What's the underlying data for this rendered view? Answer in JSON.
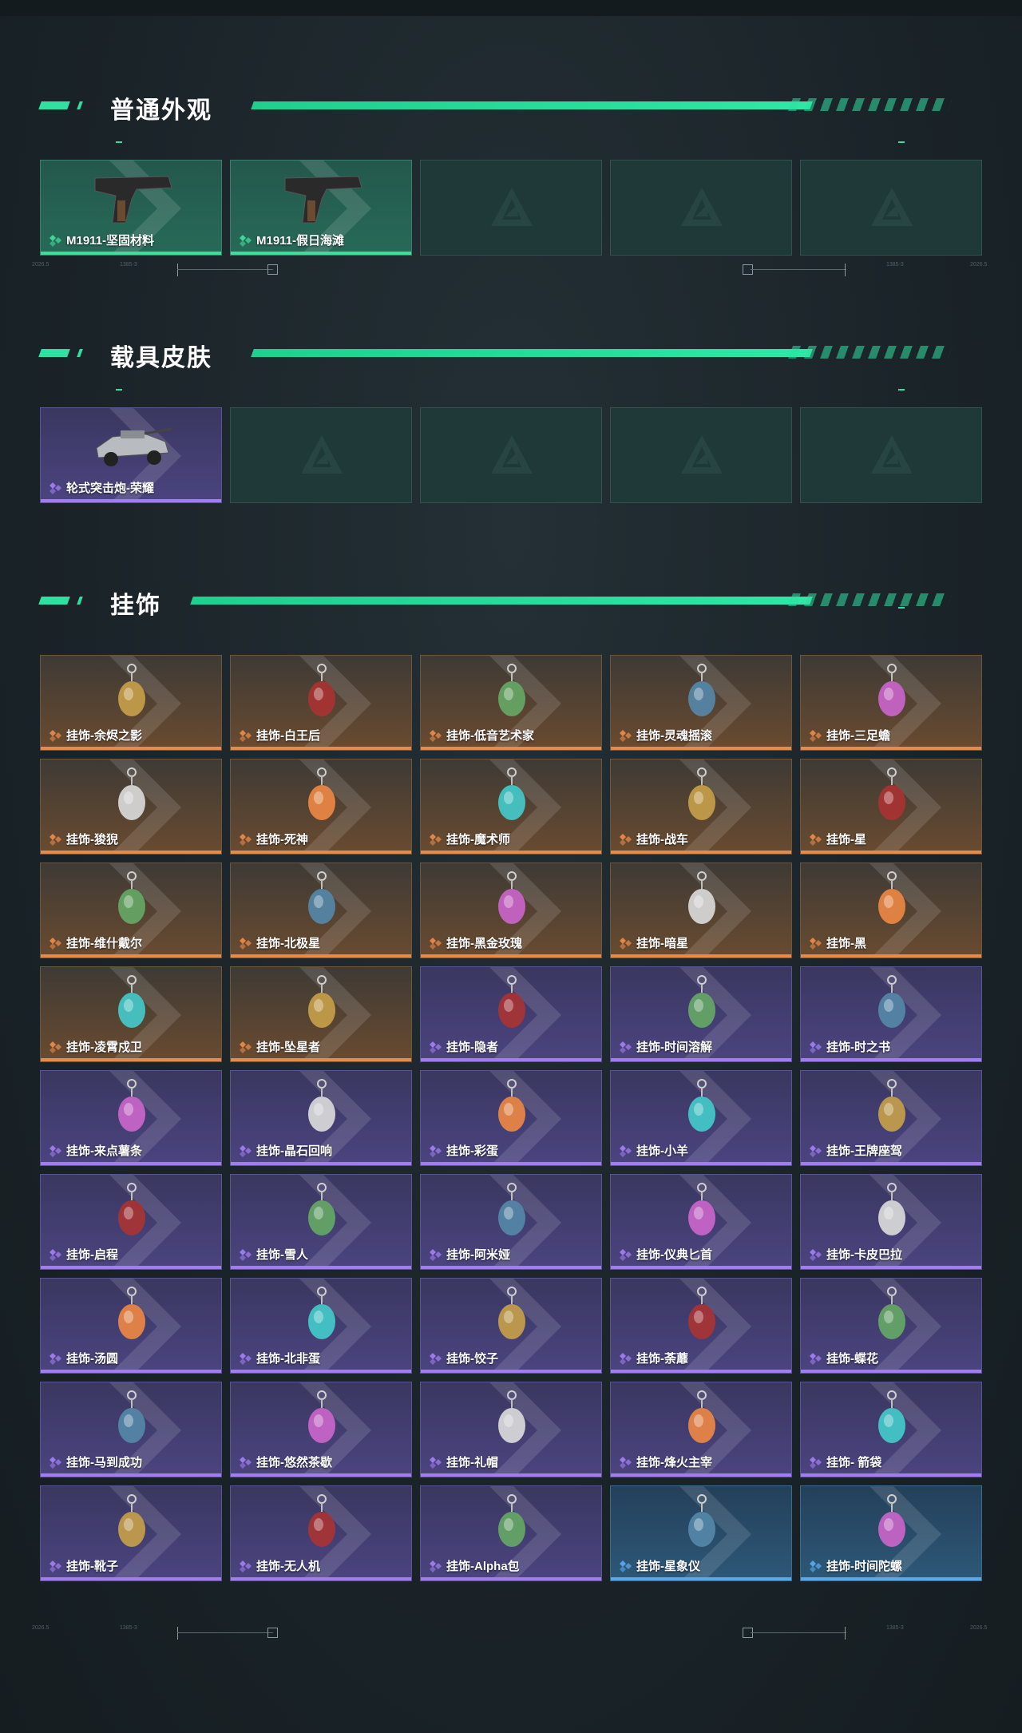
{
  "sections": {
    "normal": {
      "title": "普通外观"
    },
    "vehicle": {
      "title": "载具皮肤"
    },
    "charm": {
      "title": "挂饰"
    }
  },
  "normal_items": [
    {
      "label": "M1911-坚固材料",
      "rarity": "green"
    },
    {
      "label": "M1911-假日海滩",
      "rarity": "green"
    }
  ],
  "vehicle_items": [
    {
      "label": "轮式突击炮-荣耀",
      "rarity": "purple"
    }
  ],
  "charm_items": [
    {
      "label": "挂饰-余烬之影",
      "rarity": "orange"
    },
    {
      "label": "挂饰-白王后",
      "rarity": "orange"
    },
    {
      "label": "挂饰-低音艺术家",
      "rarity": "orange"
    },
    {
      "label": "挂饰-灵魂摇滚",
      "rarity": "orange"
    },
    {
      "label": "挂饰-三足蟾",
      "rarity": "orange"
    },
    {
      "label": "挂饰-狻猊",
      "rarity": "orange"
    },
    {
      "label": "挂饰-死神",
      "rarity": "orange"
    },
    {
      "label": "挂饰-魔术师",
      "rarity": "orange"
    },
    {
      "label": "挂饰-战车",
      "rarity": "orange"
    },
    {
      "label": "挂饰-星",
      "rarity": "orange"
    },
    {
      "label": "挂饰-维什戴尔",
      "rarity": "orange"
    },
    {
      "label": "挂饰-北极星",
      "rarity": "orange"
    },
    {
      "label": "挂饰-黑金玫瑰",
      "rarity": "orange"
    },
    {
      "label": "挂饰-暗星",
      "rarity": "orange"
    },
    {
      "label": "挂饰-黑",
      "rarity": "orange"
    },
    {
      "label": "挂饰-凌霄戍卫",
      "rarity": "orange"
    },
    {
      "label": "挂饰-坠星者",
      "rarity": "orange"
    },
    {
      "label": "挂饰-隐者",
      "rarity": "purple"
    },
    {
      "label": "挂饰-时间溶解",
      "rarity": "purple"
    },
    {
      "label": "挂饰-时之书",
      "rarity": "purple"
    },
    {
      "label": "挂饰-来点薯条",
      "rarity": "purple"
    },
    {
      "label": "挂饰-晶石回响",
      "rarity": "purple"
    },
    {
      "label": "挂饰-彩蛋",
      "rarity": "purple"
    },
    {
      "label": "挂饰-小羊",
      "rarity": "purple"
    },
    {
      "label": "挂饰-王牌座驾",
      "rarity": "purple"
    },
    {
      "label": "挂饰-启程",
      "rarity": "purple"
    },
    {
      "label": "挂饰-雪人",
      "rarity": "purple"
    },
    {
      "label": "挂饰-阿米娅",
      "rarity": "purple"
    },
    {
      "label": "挂饰-仪典匕首",
      "rarity": "purple"
    },
    {
      "label": "挂饰-卡皮巴拉",
      "rarity": "purple"
    },
    {
      "label": "挂饰-汤圆",
      "rarity": "purple"
    },
    {
      "label": "挂饰-北非蛋",
      "rarity": "purple"
    },
    {
      "label": "挂饰-饺子",
      "rarity": "purple"
    },
    {
      "label": "挂饰-荼蘼",
      "rarity": "purple"
    },
    {
      "label": "挂饰-蝶花",
      "rarity": "purple"
    },
    {
      "label": "挂饰-马到成功",
      "rarity": "purple"
    },
    {
      "label": "挂饰-悠然茶歇",
      "rarity": "purple"
    },
    {
      "label": "挂饰-礼帽",
      "rarity": "purple"
    },
    {
      "label": "挂饰-烽火主宰",
      "rarity": "purple"
    },
    {
      "label": "挂饰- 箭袋",
      "rarity": "purple"
    },
    {
      "label": "挂饰-靴子",
      "rarity": "purple"
    },
    {
      "label": "挂饰-无人机",
      "rarity": "purple"
    },
    {
      "label": "挂饰-Alpha包",
      "rarity": "purple"
    },
    {
      "label": "挂饰-星象仪",
      "rarity": "blue"
    },
    {
      "label": "挂饰-时间陀螺",
      "rarity": "blue"
    }
  ],
  "divider_text": {
    "left_a": "2026.5",
    "left_b": "1385-3",
    "right_a": "1385-3",
    "right_b": "2026.5"
  },
  "colors": {
    "accent": "#2fe0a0",
    "green": "#3fdc9a",
    "purple": "#a27cf0",
    "orange": "#e88a4a",
    "blue": "#58a8ee"
  }
}
